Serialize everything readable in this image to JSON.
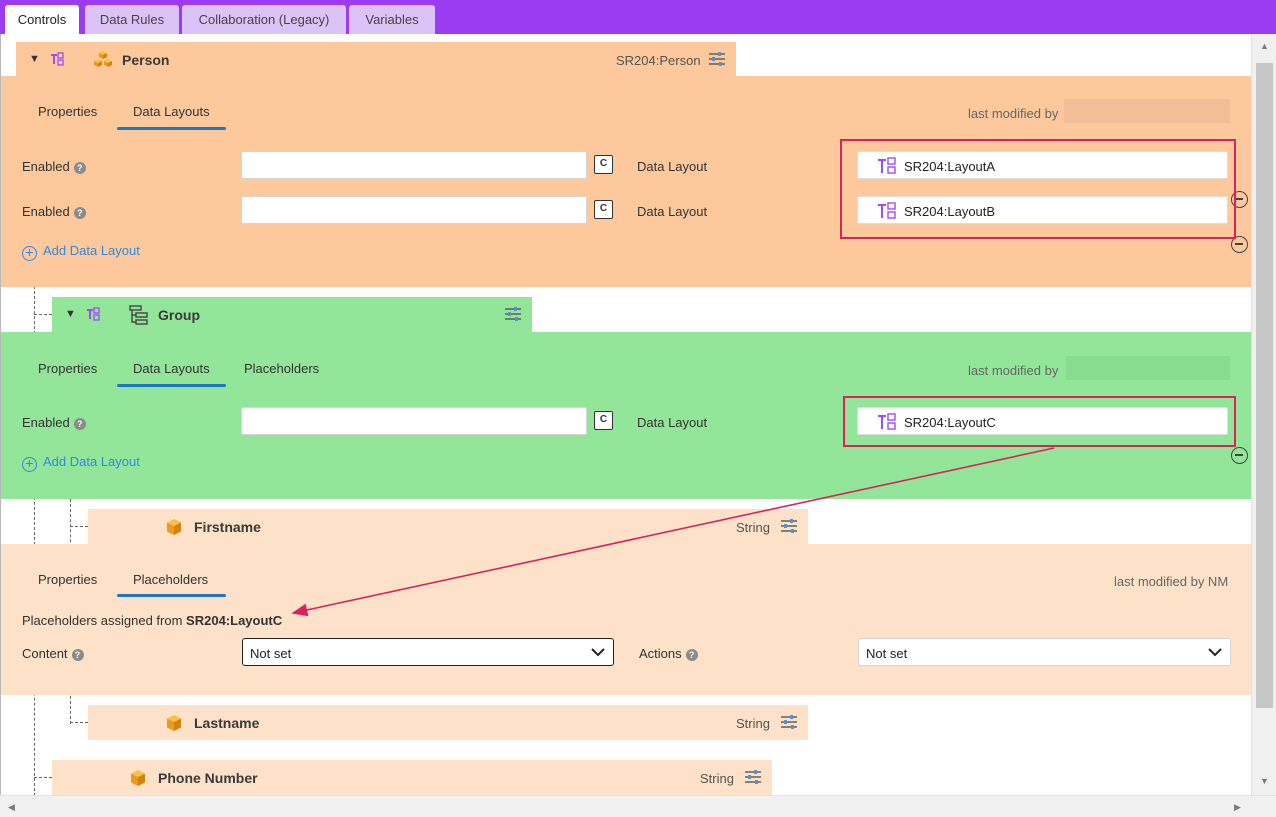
{
  "top_tabs": [
    "Controls",
    "Data Rules",
    "Collaboration (Legacy)",
    "Variables"
  ],
  "person": {
    "title": "Person",
    "type": "SR204:Person",
    "subtabs": [
      "Properties",
      "Data Layouts"
    ],
    "last_modified": "last modified by",
    "rows": [
      {
        "label": "Enabled",
        "layout_label": "Data Layout",
        "layout": "SR204:LayoutA",
        "checkbox": "C"
      },
      {
        "label": "Enabled",
        "layout_label": "Data Layout",
        "layout": "SR204:LayoutB",
        "checkbox": "C"
      }
    ],
    "add_label": "Add Data Layout"
  },
  "group": {
    "title": "Group",
    "subtabs": [
      "Properties",
      "Data Layouts",
      "Placeholders"
    ],
    "last_modified": "last modified by",
    "rows": [
      {
        "label": "Enabled",
        "layout_label": "Data Layout",
        "layout": "SR204:LayoutC",
        "checkbox": "C"
      }
    ],
    "add_label": "Add Data Layout"
  },
  "firstname": {
    "title": "Firstname",
    "type": "String",
    "subtabs": [
      "Properties",
      "Placeholders"
    ],
    "last_modified": "last modified by NM",
    "assigned_prefix": "Placeholders assigned from",
    "assigned_from": "SR204:LayoutC",
    "content_label": "Content",
    "content_value": "Not set",
    "actions_label": "Actions",
    "actions_value": "Not set"
  },
  "lastname": {
    "title": "Lastname",
    "type": "String"
  },
  "phone": {
    "title": "Phone Number",
    "type": "String"
  },
  "colors": {
    "accent": "#9b3cf2",
    "person_panel": "#fdc99c",
    "group_panel": "#93e59a",
    "field_panel": "#fde1c8",
    "highlight": "#d9225e",
    "link": "#2f8be0"
  }
}
